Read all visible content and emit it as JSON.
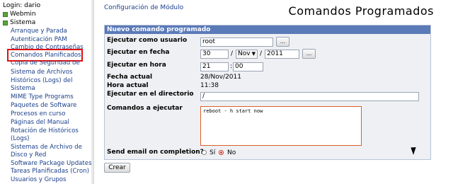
{
  "sidebar": {
    "login": "Login: dario",
    "categories": [
      "Webmin",
      "Sistema"
    ],
    "items": [
      "Arranque y Parada",
      "Autenticación PAM",
      "Cambio de Contraseñas",
      "Comandos Planificados",
      "Copia de Seguridad de",
      "Sistema de Archivos",
      "Históricos (Logs) del",
      "Sistema",
      "MIME Type Programs",
      "Paquetes de Software",
      "Procesos en curso",
      "Páginas del Manual",
      "Rotación de Históricos",
      "(Logs)",
      "Sistemas de Archivo de",
      "Disco y Red",
      "Software Package Updates",
      "Tareas Planificadas (Cron)",
      "Usuarios y Grupos"
    ]
  },
  "header": {
    "module_config": "Configuración de Módulo",
    "title": "Comandos Programados"
  },
  "form": {
    "section_title": "Nuevo comando programado",
    "run_as_label": "Ejecutar como usuario",
    "run_as_value": "root",
    "run_as_button": "...",
    "date_label": "Ejecutar en fecha",
    "day": "30",
    "month": "Nov",
    "year": "2011",
    "date_button": "...",
    "date_sep": "/",
    "time_label": "Ejecutar en hora",
    "hour": "21",
    "minute": "00",
    "time_sep": ":",
    "current_date_label": "Fecha actual",
    "current_date_value": "28/Nov/2011",
    "current_time_label": "Hora actual",
    "current_time_value": "11:38",
    "dir_label": "Ejecutar en el directorio",
    "dir_value": "/",
    "commands_label": "Comandos a ejecutar",
    "commands_value": "reboot - h start now",
    "email_label": "Send email on completion?",
    "email_yes": "Sí",
    "email_no": "No",
    "email_selected": "No",
    "create_button": "Crear"
  }
}
